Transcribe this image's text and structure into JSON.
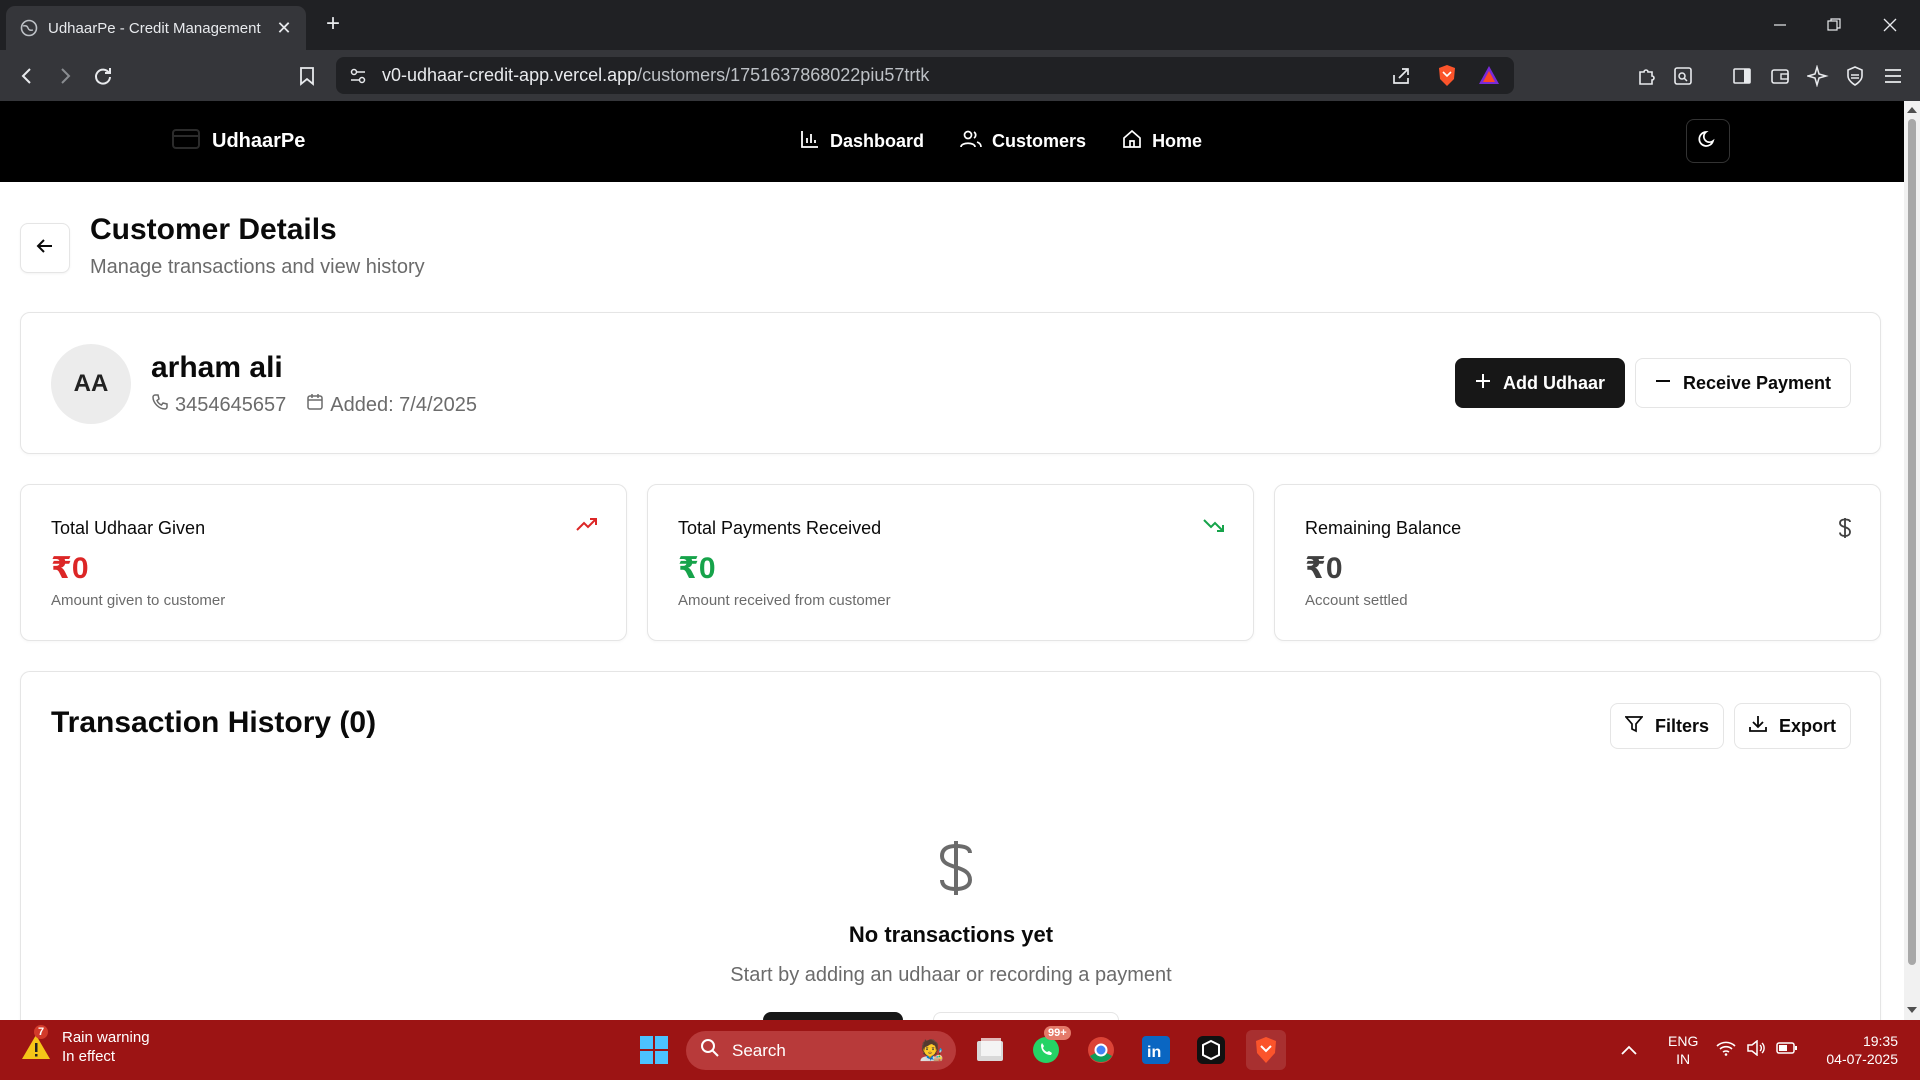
{
  "browser": {
    "tab_title": "UdhaarPe - Credit Management",
    "url_host": "v0-udhaar-credit-app.vercel.app",
    "url_path": "/customers/1751637868022piu57trtk"
  },
  "nav": {
    "brand": "UdhaarPe",
    "links": [
      {
        "label": "Dashboard",
        "icon": "bar-chart-icon"
      },
      {
        "label": "Customers",
        "icon": "users-icon"
      },
      {
        "label": "Home",
        "icon": "home-icon"
      }
    ],
    "theme_toggle_icon": "moon-icon"
  },
  "page": {
    "title": "Customer Details",
    "subtitle": "Manage transactions and view history"
  },
  "customer": {
    "initials": "AA",
    "name": "arham ali",
    "phone": "3454645657",
    "added": "Added: 7/4/2025",
    "add_udhaar_label": "Add Udhaar",
    "receive_payment_label": "Receive Payment"
  },
  "stats": [
    {
      "title": "Total Udhaar Given",
      "value": "₹0",
      "desc": "Amount given to customer",
      "color": "#dc2626",
      "icon": "trending-up-icon"
    },
    {
      "title": "Total Payments Received",
      "value": "₹0",
      "desc": "Amount received from customer",
      "color": "#16a34a",
      "icon": "trending-down-icon"
    },
    {
      "title": "Remaining Balance",
      "value": "₹0",
      "desc": "Account settled",
      "color": "#404040",
      "icon": "dollar-icon"
    }
  ],
  "transactions": {
    "title": "Transaction History (0)",
    "filters_label": "Filters",
    "export_label": "Export",
    "empty_title": "No transactions yet",
    "empty_subtitle": "Start by adding an udhaar or recording a payment"
  },
  "taskbar": {
    "weather_badge": "7",
    "weather_title": "Rain warning",
    "weather_sub": "In effect",
    "search_placeholder": "Search",
    "whatsapp_badge": "99+",
    "lang": "ENG",
    "region": "IN",
    "time": "19:35",
    "date": "04-07-2025"
  },
  "colors": {
    "accent_dark": "#171717",
    "udhaar_red": "#dc2626",
    "payment_green": "#16a34a",
    "taskbar": "#9c1414"
  }
}
